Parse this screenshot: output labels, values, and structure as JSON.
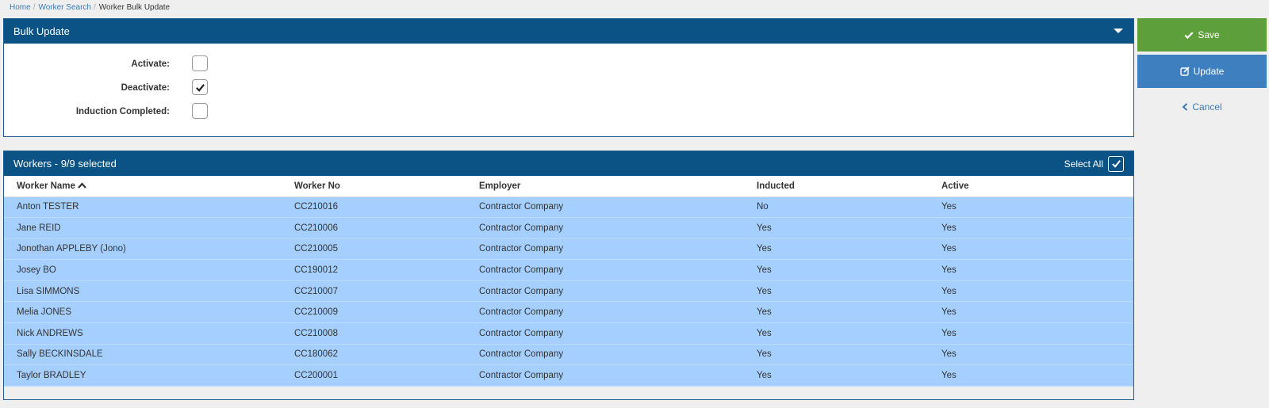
{
  "breadcrumb": {
    "home": "Home",
    "worker_search": "Worker Search",
    "current": "Worker Bulk Update",
    "separator": "/"
  },
  "bulk_update": {
    "title": "Bulk Update",
    "fields": [
      {
        "label": "Activate:",
        "checked": false
      },
      {
        "label": "Deactivate:",
        "checked": true
      },
      {
        "label": "Induction Completed:",
        "checked": false
      }
    ]
  },
  "workers": {
    "title": "Workers - 9/9 selected",
    "select_all_label": "Select All",
    "select_all_checked": true,
    "columns": [
      "Worker Name",
      "Worker No",
      "Employer",
      "Inducted",
      "Active"
    ],
    "rows": [
      [
        "Anton TESTER",
        "CC210016",
        "Contractor Company",
        "No",
        "Yes"
      ],
      [
        "Jane REID",
        "CC210006",
        "Contractor Company",
        "Yes",
        "Yes"
      ],
      [
        "Jonothan APPLEBY (Jono)",
        "CC210005",
        "Contractor Company",
        "Yes",
        "Yes"
      ],
      [
        "Josey BO",
        "CC190012",
        "Contractor Company",
        "Yes",
        "Yes"
      ],
      [
        "Lisa SIMMONS",
        "CC210007",
        "Contractor Company",
        "Yes",
        "Yes"
      ],
      [
        "Melia JONES",
        "CC210009",
        "Contractor Company",
        "Yes",
        "Yes"
      ],
      [
        "Nick ANDREWS",
        "CC210008",
        "Contractor Company",
        "Yes",
        "Yes"
      ],
      [
        "Sally BECKINSDALE",
        "CC180062",
        "Contractor Company",
        "Yes",
        "Yes"
      ],
      [
        "Taylor BRADLEY",
        "CC200001",
        "Contractor Company",
        "Yes",
        "Yes"
      ]
    ]
  },
  "actions": {
    "save": "Save",
    "update": "Update",
    "cancel": "Cancel"
  },
  "colors": {
    "header": "#0b5384",
    "save": "#5d9f3b",
    "update": "#3e7fbf",
    "row_selected": "#a4cfff",
    "link": "#3c7ab6"
  },
  "icons": {
    "collapse": "caret-down-icon",
    "sort": "chevron-up-icon",
    "save": "check-icon",
    "update": "edit-icon",
    "cancel": "chevron-left-icon"
  }
}
